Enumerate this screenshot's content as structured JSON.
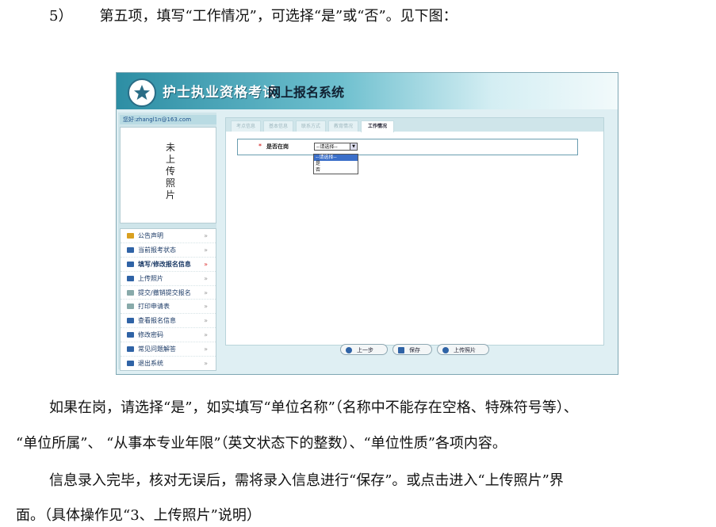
{
  "intro": {
    "num": "5）",
    "text": "第五项，填写“工作情况”，可选择“是”或“否”。见下图："
  },
  "shot": {
    "banner": {
      "title_main": "护士执业资格考试",
      "title_sub": "网上报名系统"
    },
    "user_greeting": "您好:zhangl1n@163.com",
    "photo_placeholder": [
      "未",
      "上",
      "传",
      "照",
      "片"
    ],
    "menu": [
      {
        "label": "公告声明"
      },
      {
        "label": "当前报考状态"
      },
      {
        "label": "填写/修改报名信息"
      },
      {
        "label": "上传照片"
      },
      {
        "label": "提交/撤销提交报名"
      },
      {
        "label": "打印申请表"
      },
      {
        "label": "查看报名信息"
      },
      {
        "label": "修改密码"
      },
      {
        "label": "常见问题解答"
      },
      {
        "label": "退出系统"
      }
    ],
    "tabs": [
      "考点信息",
      "基本信息",
      "联系方式",
      "教育情况",
      "工作情况"
    ],
    "form": {
      "required_mark": "*",
      "label": "是否在岗",
      "select_value": "--请选择--",
      "options": [
        "--请选择--",
        "是",
        "否"
      ]
    },
    "buttons": {
      "prev": "上一步",
      "save": "保存",
      "upload": "上传照片"
    }
  },
  "body": {
    "p1": "如果在岗，请选择“是”，如实填写“单位名称”（名称中不能存在空格、特殊符号等）、",
    "p2": "“单位所属”、 “从事本专业年限”（英文状态下的整数）、“单位性质”各项内容。",
    "p3": "信息录入完毕，核对无误后，需将录入信息进行“保存”。或点击进入“上传照片”界",
    "p4": "面。（具体操作见“3、上传照片”说明）"
  },
  "colors": {
    "accent": "#2d8ea4",
    "menu_text": "#1b3a66",
    "highlight": "#3b6fc9"
  }
}
